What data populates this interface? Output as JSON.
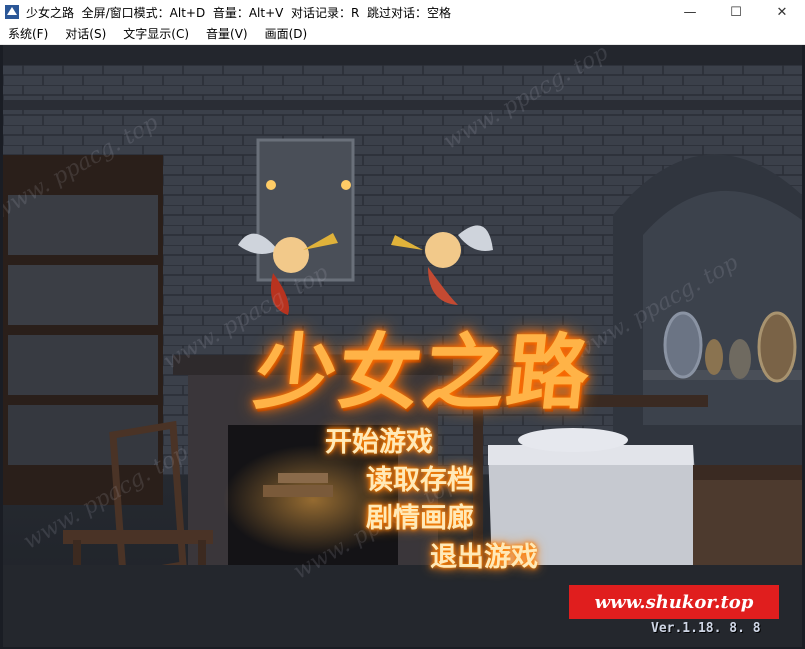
{
  "window": {
    "title": "少女之路  全屏/窗口模式：Alt+D  音量：Alt+V  对话记录：R  跳过对话：空格",
    "minimize": "—",
    "maximize": "☐",
    "close": "✕"
  },
  "menubar": {
    "items": [
      "系统(F)",
      "对话(S)",
      "文字显示(C)",
      "音量(V)",
      "画面(D)"
    ]
  },
  "game": {
    "logo": "少女之路",
    "options": {
      "start": "开始游戏",
      "load": "读取存档",
      "gallery": "剧情画廊",
      "exit": "退出游戏"
    },
    "banner": "www.shukor.top",
    "version": "Ver.1.18. 8. 8",
    "watermark": "www. ppacg. top"
  },
  "colors": {
    "logo_glow": "#ff7b00",
    "option_glow": "#ff8a00",
    "banner_bg": "#e01e1e"
  }
}
